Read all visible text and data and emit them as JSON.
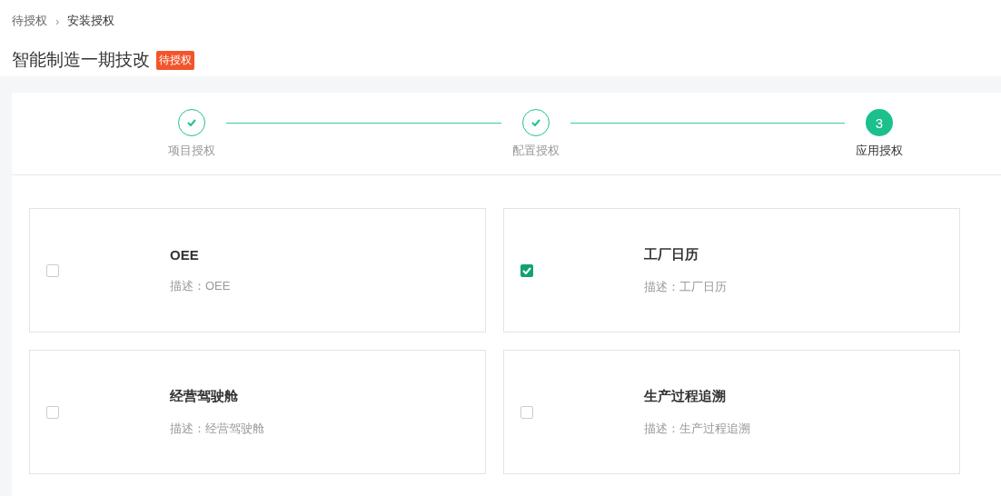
{
  "breadcrumb": [
    {
      "label": "待授权"
    },
    {
      "label": "安装授权"
    }
  ],
  "breadcrumb_separator": "›",
  "title": "智能制造一期技改",
  "status_tag": "待授权",
  "steps": [
    {
      "label": "项目授权",
      "done": true
    },
    {
      "label": "配置授权",
      "done": true
    },
    {
      "label": "应用授权",
      "done": false,
      "number": "3"
    }
  ],
  "apps": [
    {
      "name": "OEE",
      "description": "描述：OEE",
      "checked": false
    },
    {
      "name": "工厂日历",
      "description": "描述：工厂日历",
      "checked": true
    },
    {
      "name": "经营驾驶舱",
      "description": "描述：经营驾驶舱",
      "checked": false
    },
    {
      "name": "生产过程追溯",
      "description": "描述：生产过程追溯",
      "checked": false
    }
  ]
}
